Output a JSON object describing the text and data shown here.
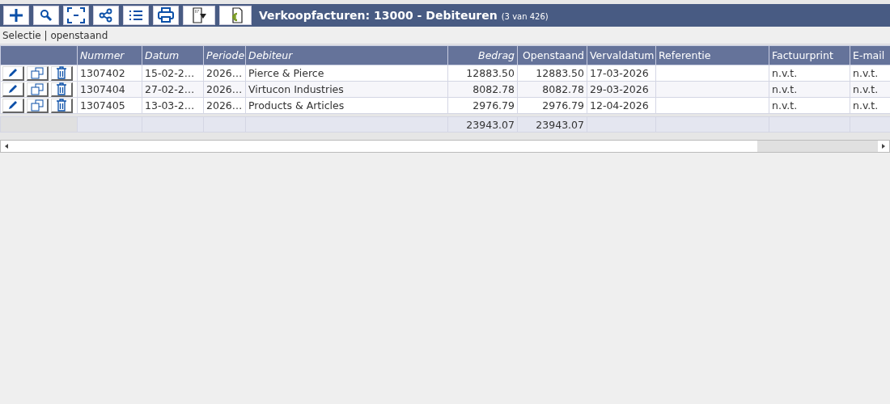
{
  "title": "Verkoopfacturen: 13000 - Debiteuren",
  "count": "(3 van 426)",
  "toolbar": [
    {
      "kind": "plus"
    },
    {
      "kind": "search"
    },
    {
      "kind": "select"
    },
    {
      "kind": "share"
    },
    {
      "kind": "list"
    },
    {
      "kind": "print"
    },
    {
      "kind": "doc"
    },
    {
      "kind": "euro"
    }
  ],
  "selection": "Selectie | openstaand",
  "columns": [
    {
      "label": "Nummer",
      "italic": true,
      "kind": "text"
    },
    {
      "label": "Datum",
      "italic": true,
      "kind": "text"
    },
    {
      "label": "Periode",
      "italic": true,
      "kind": "text"
    },
    {
      "label": "Debiteur",
      "italic": true,
      "kind": "text"
    },
    {
      "label": "Bedrag",
      "italic": true,
      "kind": "amount",
      "total": "23943.07"
    },
    {
      "label": "Openstaand",
      "italic": false,
      "kind": "amount",
      "total": "23943.07"
    },
    {
      "label": "Vervaldatum",
      "italic": false,
      "kind": "text"
    },
    {
      "label": "Referentie",
      "italic": false,
      "kind": "text"
    },
    {
      "label": "Factuurprint",
      "italic": false,
      "kind": "text"
    },
    {
      "label": "E-mail",
      "italic": false,
      "kind": "text"
    }
  ],
  "rows": [
    [
      "1307402",
      "15-02-2…",
      "2026…",
      "Pierce & Pierce",
      "12883.50",
      "12883.50",
      "17-03-2026",
      "",
      "n.v.t.",
      "n.v.t."
    ],
    [
      "1307404",
      "27-02-2…",
      "2026…",
      "Virtucon Industries",
      "8082.78",
      "8082.78",
      "29-03-2026",
      "",
      "n.v.t.",
      "n.v.t."
    ],
    [
      "1307405",
      "13-03-2…",
      "2026…",
      "Products & Articles",
      "2976.79",
      "2976.79",
      "12-04-2026",
      "",
      "n.v.t.",
      "n.v.t."
    ]
  ]
}
